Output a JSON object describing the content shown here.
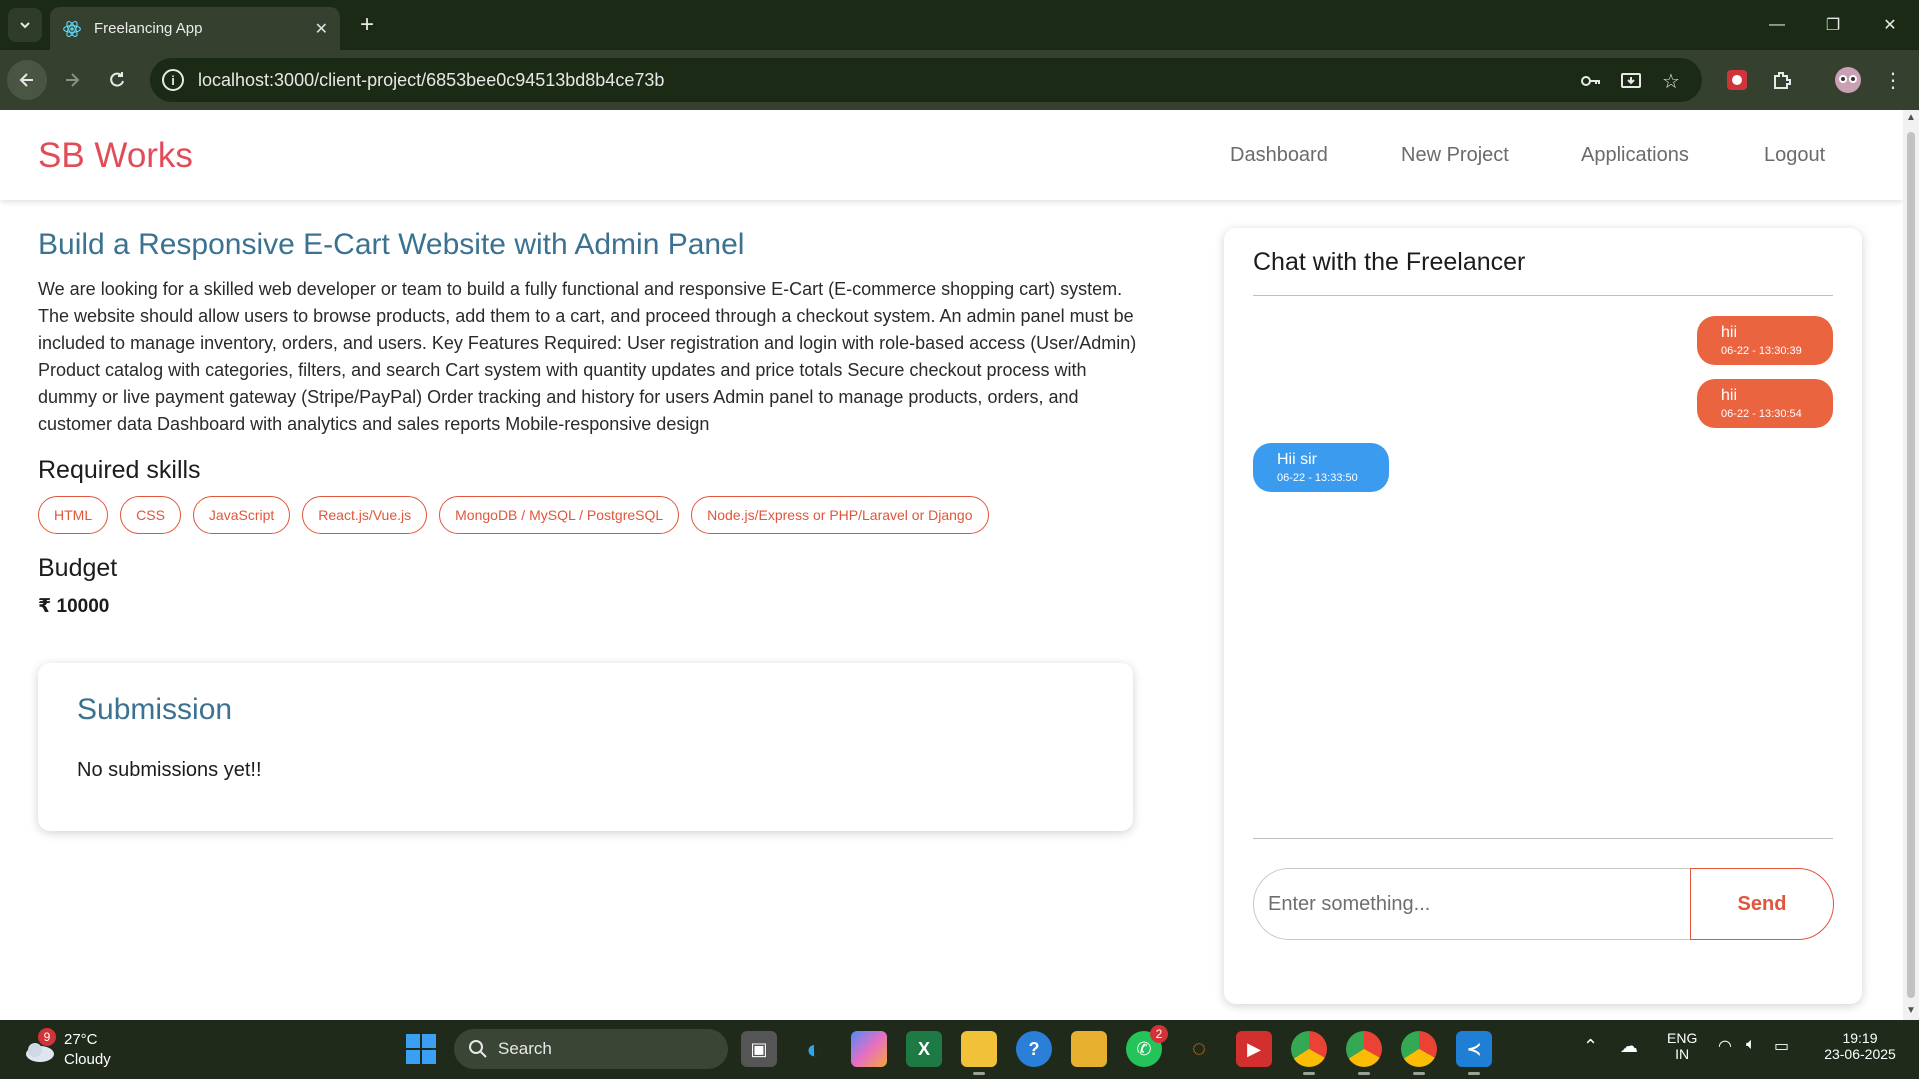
{
  "browser": {
    "tab_title": "Freelancing App",
    "url": "localhost:3000/client-project/6853bee0c94513bd8b4ce73b"
  },
  "app": {
    "brand": "SB Works",
    "nav": [
      "Dashboard",
      "New Project",
      "Applications",
      "Logout"
    ]
  },
  "project": {
    "title": "Build a Responsive E-Cart Website with Admin Panel",
    "description": "We are looking for a skilled web developer or team to build a fully functional and responsive E-Cart (E-commerce shopping cart) system. The website should allow users to browse products, add them to a cart, and proceed through a checkout system. An admin panel must be included to manage inventory, orders, and users. Key Features Required: User registration and login with role-based access (User/Admin) Product catalog with categories, filters, and search Cart system with quantity updates and price totals Secure checkout process with dummy or live payment gateway (Stripe/PayPal) Order tracking and history for users Admin panel to manage products, orders, and customer data Dashboard with analytics and sales reports Mobile-responsive design",
    "skills_heading": "Required skills",
    "skills": [
      "HTML",
      "CSS",
      "JavaScript",
      "React.js/Vue.js",
      "MongoDB / MySQL / PostgreSQL",
      "Node.js/Express or PHP/Laravel or Django"
    ],
    "budget_heading": "Budget",
    "budget": "₹ 10000"
  },
  "submission": {
    "heading": "Submission",
    "empty_text": "No submissions yet!!"
  },
  "chat": {
    "title": "Chat with the Freelancer",
    "messages": [
      {
        "text": "hii",
        "time": "06-22 - 13:30:39",
        "direction": "sent"
      },
      {
        "text": "hii",
        "time": "06-22 - 13:30:54",
        "direction": "sent"
      },
      {
        "text": "Hii sir",
        "time": "06-22 - 13:33:50",
        "direction": "received"
      }
    ],
    "input_placeholder": "Enter something...",
    "send_label": "Send"
  },
  "taskbar": {
    "weather_badge": "9",
    "temperature": "27°C",
    "condition": "Cloudy",
    "search_label": "Search",
    "whatsapp_badge": "2",
    "language_line1": "ENG",
    "language_line2": "IN",
    "time": "19:19",
    "date": "23-06-2025"
  },
  "colors": {
    "brand": "#e04d58",
    "title_blue": "#3b7291",
    "accent_orange": "#e0563b",
    "sent_bubble": "#ea6440",
    "received_bubble": "#3b9bef"
  }
}
